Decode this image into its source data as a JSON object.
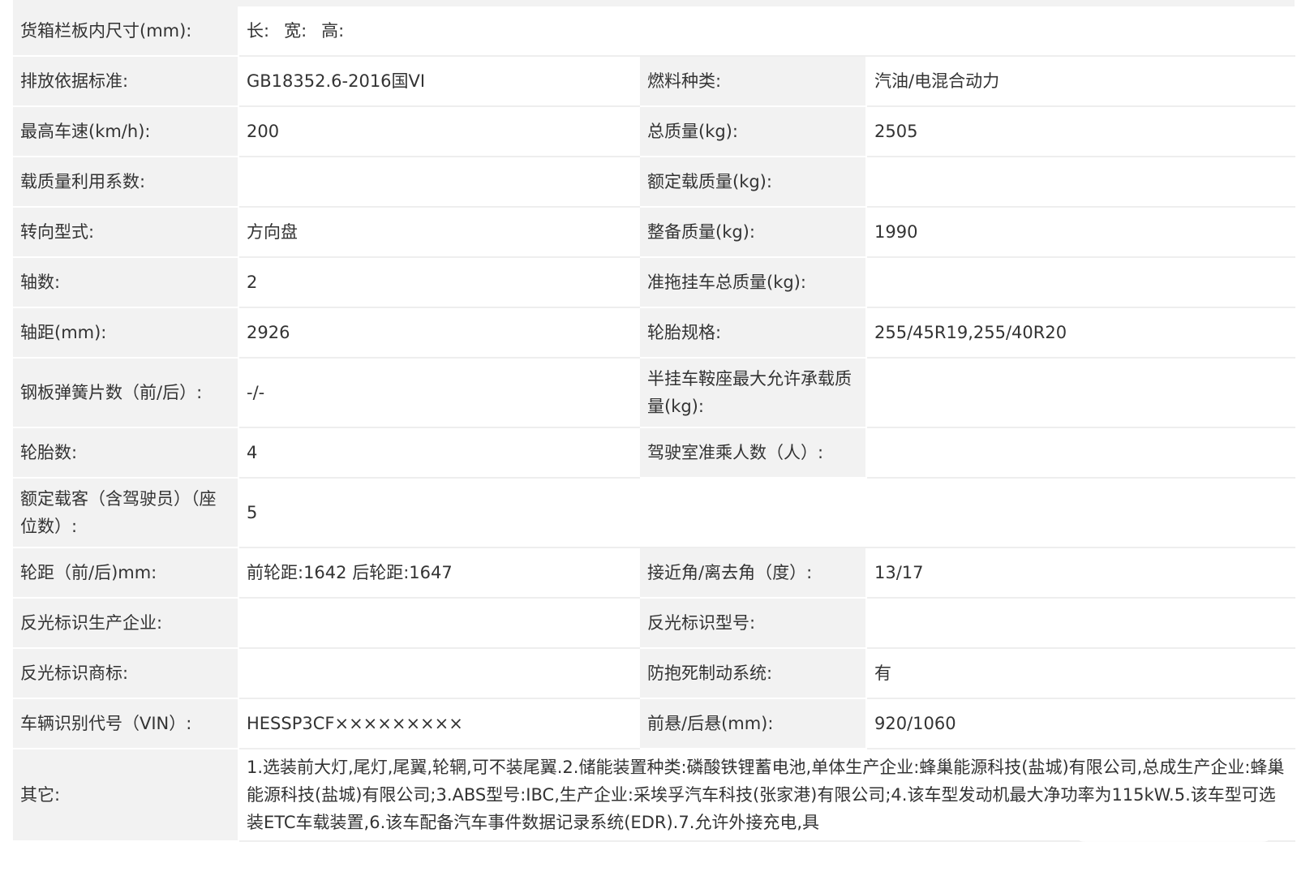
{
  "rows": [
    {
      "label": "货箱栏板内尺寸(mm):",
      "dims": {
        "len": "长:",
        "wid": "宽:",
        "hei": "高:"
      }
    },
    {
      "l1": "排放依据标准:",
      "v1": "GB18352.6-2016国VI",
      "l2": "燃料种类:",
      "v2": "汽油/电混合动力"
    },
    {
      "l1": "最高车速(km/h):",
      "v1": "200",
      "l2": "总质量(kg):",
      "v2": "2505"
    },
    {
      "l1": "载质量利用系数:",
      "v1": "",
      "l2": "额定载质量(kg):",
      "v2": ""
    },
    {
      "l1": "转向型式:",
      "v1": "方向盘",
      "l2": "整备质量(kg):",
      "v2": "1990"
    },
    {
      "l1": "轴数:",
      "v1": "2",
      "l2": "准拖挂车总质量(kg):",
      "v2": ""
    },
    {
      "l1": "轴距(mm):",
      "v1": "2926",
      "l2": "轮胎规格:",
      "v2": "255/45R19,255/40R20"
    },
    {
      "l1": "钢板弹簧片数（前/后）:",
      "v1": "-/-",
      "l2": "半挂车鞍座最大允许承载质量(kg):",
      "v2": ""
    },
    {
      "l1": "轮胎数:",
      "v1": "4",
      "l2": "驾驶室准乘人数（人）:",
      "v2": ""
    },
    {
      "label": "额定载客（含驾驶员）（座位数）:",
      "value": "5"
    },
    {
      "l1": "轮距（前/后)mm:",
      "v1": "前轮距:1642 后轮距:1647",
      "l2": "接近角/离去角（度）:",
      "v2": "13/17"
    },
    {
      "l1": "反光标识生产企业:",
      "v1": "",
      "l2": "反光标识型号:",
      "v2": ""
    },
    {
      "l1": "反光标识商标:",
      "v1": "",
      "l2": "防抱死制动系统:",
      "v2": "有"
    },
    {
      "l1": "车辆识别代号（VIN）:",
      "v1": "HESSP3CF×××××××××",
      "l2": "前悬/后悬(mm):",
      "v2": "920/1060"
    },
    {
      "label": "其它:",
      "value": "1.选装前大灯,尾灯,尾翼,轮辋,可不装尾翼.2.储能装置种类:磷酸铁锂蓄电池,单体生产企业:蜂巢能源科技(盐城)有限公司,总成生产企业:蜂巢能源科技(盐城)有限公司;3.ABS型号:IBC,生产企业:采埃孚汽车科技(张家港)有限公司;4.该车型发动机最大净功率为115kW.5.该车型可选装ETC车载装置,6.该车配备汽车事件数据记录系统(EDR).7.允许外接充电,具"
    }
  ]
}
